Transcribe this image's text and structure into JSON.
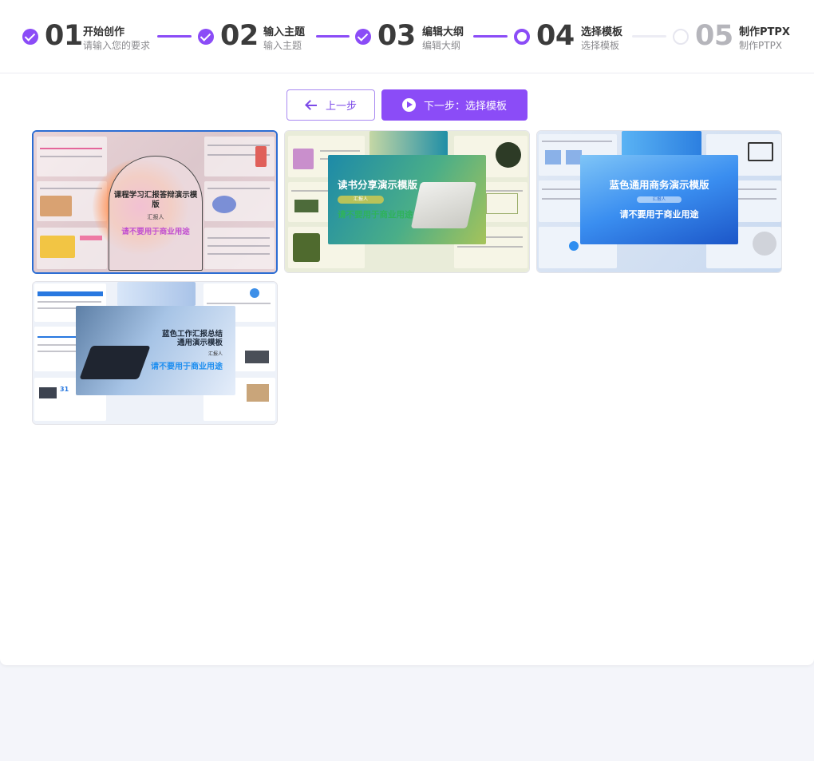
{
  "steps": [
    {
      "num": "01",
      "title": "开始创作",
      "sub": "请输入您的要求",
      "state": "done"
    },
    {
      "num": "02",
      "title": "输入主题",
      "sub": "输入主题",
      "state": "done"
    },
    {
      "num": "03",
      "title": "编辑大纲",
      "sub": "编辑大纲",
      "state": "done"
    },
    {
      "num": "04",
      "title": "选择模板",
      "sub": "选择模板",
      "state": "active"
    },
    {
      "num": "05",
      "title": "制作PTPX",
      "sub": "制作PTPX",
      "state": "pending"
    }
  ],
  "actions": {
    "prev_label": "上一步",
    "next_label": "下一步：选择模板"
  },
  "templates": [
    {
      "title": "课程学习汇报答辩演示模版",
      "byline": "汇报人",
      "notice": "请不要用于商业用途",
      "selected": true,
      "accent": "#c14fd0"
    },
    {
      "title": "读书分享演示模版",
      "byline": "汇报人",
      "notice": "请不要用于商业用途",
      "selected": false,
      "accent": "#2fb25c"
    },
    {
      "title": "蓝色通用商务演示模版",
      "byline": "汇报人",
      "notice": "请不要用于商业用途",
      "selected": false,
      "accent": "#ffffff"
    },
    {
      "title": "蓝色工作汇报总结通用演示模板",
      "byline": "汇报人",
      "notice": "请不要用于商业用途",
      "selected": false,
      "accent": "#1f8ff0"
    }
  ],
  "colors": {
    "primary": "#8b4cf7",
    "selected_border": "#2c6dd3"
  }
}
